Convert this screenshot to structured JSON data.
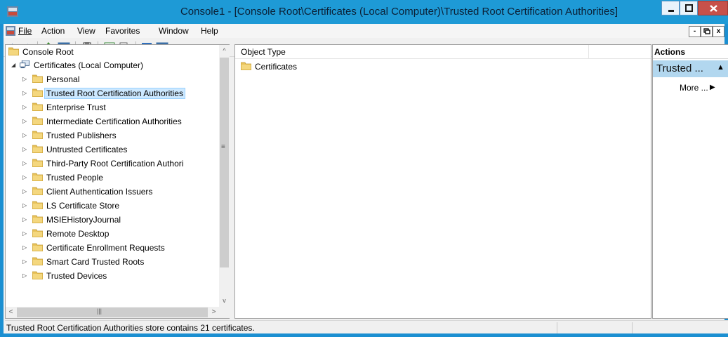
{
  "window": {
    "title": "Console1 - [Console Root\\Certificates (Local Computer)\\Trusted Root Certification Authorities]",
    "minimize_glyph": "▬",
    "maximize_glyph": "□",
    "close_glyph": "x"
  },
  "menu": {
    "items": [
      "File",
      "Action",
      "View",
      "Favorites",
      "Window",
      "Help"
    ],
    "mdi_min": "-",
    "mdi_restore": "ā",
    "mdi_close": "x"
  },
  "toolbar": {
    "buttons": [
      "back-icon",
      "forward-icon",
      "up-level-icon",
      "show-hide-console-tree-icon",
      "properties-icon",
      "refresh-icon",
      "export-list-icon",
      "help-icon",
      "show-hide-action-pane-icon"
    ]
  },
  "tree": {
    "root": "Console Root",
    "certificates": "Certificates (Local Computer)",
    "stores": [
      "Personal",
      "Trusted Root Certification Authorities",
      "Enterprise Trust",
      "Intermediate Certification Authorities",
      "Trusted Publishers",
      "Untrusted Certificates",
      "Third-Party Root Certification Authori",
      "Trusted People",
      "Client Authentication Issuers",
      "LS Certificate Store",
      "MSIEHistoryJournal",
      "Remote Desktop",
      "Certificate Enrollment Requests",
      "Smart Card Trusted Roots",
      "Trusted Devices"
    ],
    "selected_index": 1
  },
  "center": {
    "column_header": "Object Type",
    "items": [
      "Certificates"
    ]
  },
  "actions": {
    "header": "Actions",
    "group": "Trusted ...",
    "more": "More ..."
  },
  "status": {
    "text": "Trusted Root Certification Authorities store contains 21 certificates."
  },
  "colors": {
    "title_bar": "#1e9ad6",
    "selection": "#cce8ff",
    "actions_group": "#b2d7ef",
    "folder": "#e8c25a"
  }
}
